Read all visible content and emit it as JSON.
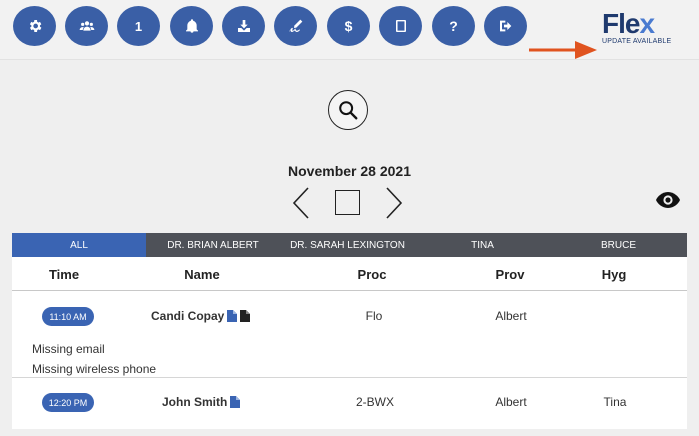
{
  "toolbar": {
    "buttons": [
      {
        "name": "settings",
        "icon": "gear-icon"
      },
      {
        "name": "patients",
        "icon": "users-icon"
      },
      {
        "name": "count",
        "label": "1"
      },
      {
        "name": "notifications",
        "icon": "bell-icon"
      },
      {
        "name": "download",
        "icon": "download-icon"
      },
      {
        "name": "sign",
        "icon": "signature-icon"
      },
      {
        "name": "billing",
        "label": "$"
      },
      {
        "name": "tablet",
        "icon": "tablet-icon"
      },
      {
        "name": "help",
        "label": "?"
      },
      {
        "name": "logout",
        "icon": "logout-icon"
      }
    ],
    "accent": "#3a5fa6"
  },
  "logo": {
    "word_main": "Fle",
    "word_x": "x",
    "subtitle": "UPDATE AVAILABLE"
  },
  "date": "November 28 2021",
  "tabs": [
    {
      "label": "ALL",
      "active": true
    },
    {
      "label": "DR. BRIAN ALBERT",
      "active": false
    },
    {
      "label": "DR. SARAH LEXINGTON",
      "active": false
    },
    {
      "label": "TINA",
      "active": false
    },
    {
      "label": "BRUCE",
      "active": false
    }
  ],
  "table": {
    "headers": {
      "time": "Time",
      "name": "Name",
      "proc": "Proc",
      "prov": "Prov",
      "hyg": "Hyg"
    },
    "rows": [
      {
        "time": "11:10 AM",
        "name": "Candi Copay",
        "proc": "Flo",
        "prov": "Albert",
        "hyg": "",
        "notes": [
          "Missing email",
          "Missing wireless phone"
        ]
      },
      {
        "time": "12:20 PM",
        "name": "John Smith",
        "proc": "2-BWX",
        "prov": "Albert",
        "hyg": "Tina",
        "notes": []
      }
    ]
  },
  "colors": {
    "tab_active": "#3a64b3",
    "tab_bar": "#4e5158",
    "arrow": "#e0531f",
    "doc_blue": "#3a64b3"
  }
}
